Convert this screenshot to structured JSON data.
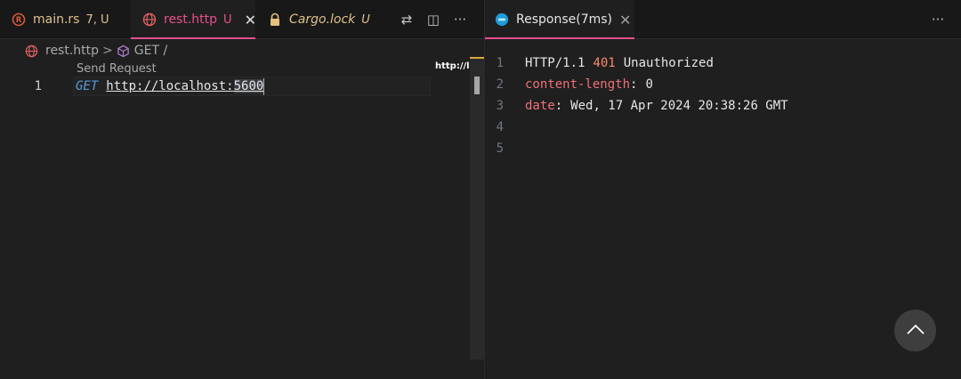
{
  "left": {
    "tabs": [
      {
        "label": "main.rs",
        "badge": "7, U",
        "icon": "rust-icon"
      },
      {
        "label": "rest.http",
        "badge": "U",
        "icon": "globe-icon",
        "close": "✕"
      },
      {
        "label": "Cargo.lock",
        "badge": "U",
        "icon": "lock-icon"
      }
    ],
    "actions": {
      "compare": "⇄",
      "split": "◫",
      "more": "···"
    },
    "breadcrumb": {
      "file": "rest.http",
      "separator": ">",
      "symbol": "GET /"
    },
    "codelens": "Send Request",
    "editor": {
      "line_number": "1",
      "method": "GET",
      "url_prefix": "http://localhost:",
      "port": "5600"
    },
    "minimap_label": "http://l..."
  },
  "right": {
    "tab": {
      "label": "Response(7ms)",
      "close": "✕",
      "icon": "response-icon"
    },
    "more": "···",
    "lines": [
      {
        "no": "1",
        "proto": "HTTP/1.1",
        "code": "401",
        "reason": "Unauthorized"
      },
      {
        "no": "2",
        "key": "content-length",
        "colon": ":",
        "value": "0"
      },
      {
        "no": "3",
        "key": "date",
        "colon": ":",
        "value": "Wed, 17 Apr 2024 20:38:26 GMT"
      },
      {
        "no": "4"
      },
      {
        "no": "5"
      }
    ]
  },
  "colors": {
    "accent": "#e8508c",
    "rust": "#d85a3a",
    "modified": "#e2c08d",
    "keyword": "#569cd6",
    "header_key": "#f07178",
    "status_code": "#f78c6c"
  }
}
